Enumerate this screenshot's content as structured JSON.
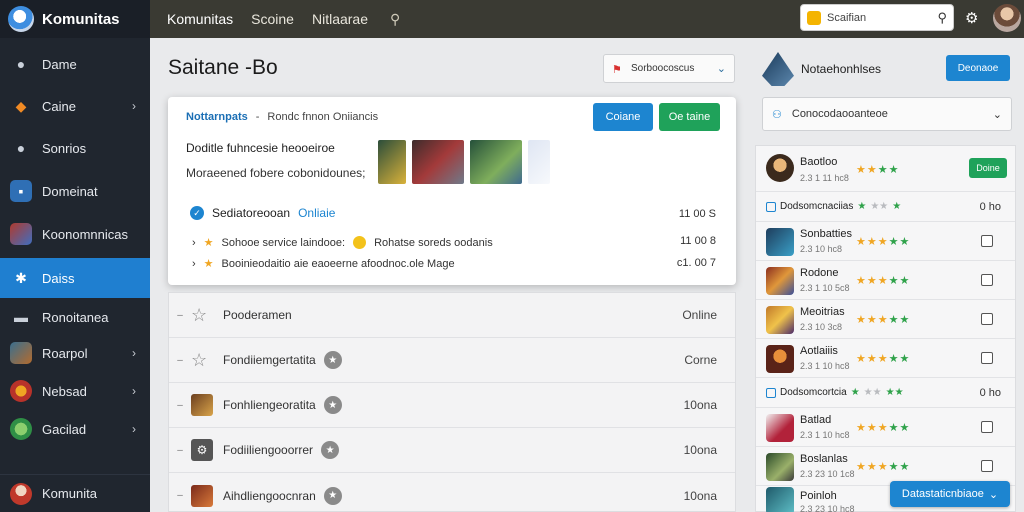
{
  "app": {
    "name": "Komunitas"
  },
  "sidebar": {
    "items": [
      {
        "label": "Dame",
        "icon": "user-icon",
        "chevron": false
      },
      {
        "label": "Caine",
        "icon": "shield-icon",
        "chevron": true
      },
      {
        "label": "Sonrios",
        "icon": "chat-icon",
        "chevron": false
      },
      {
        "label": "Domeinat",
        "icon": "app-icon",
        "chevron": false
      },
      {
        "label": "Koonomnnicas",
        "icon": "game-icon",
        "chevron": false
      },
      {
        "label": "Daiss",
        "icon": "network-icon",
        "chevron": false,
        "active": true
      },
      {
        "label": "Ronoitanea",
        "icon": "card-icon",
        "chevron": false
      },
      {
        "label": "Roarpol",
        "icon": "game2-icon",
        "chevron": true
      },
      {
        "label": "Nebsad",
        "icon": "flame-icon",
        "chevron": true
      },
      {
        "label": "Gacilad",
        "icon": "globe-icon",
        "chevron": true
      }
    ],
    "footer": {
      "label": "Komunita",
      "icon": "avatar-icon"
    }
  },
  "topbar": {
    "tabs": [
      "Komunitas",
      "Scoine",
      "Nitlaarae"
    ],
    "search_placeholder": "Scaifian"
  },
  "main": {
    "title": "Saitane -Bo",
    "select_value": "Sorboocoscus",
    "card": {
      "head_lead": "Nottarnpats",
      "head_sep": "-",
      "head_text": "Rondc fnnon Oniiancis",
      "btn_primary": "Coiane",
      "btn_secondary": "Oe taine",
      "line1": "Doditle fuhncesie",
      "line1_tail": "heooeiroe",
      "line2": "Moraeened fobere cobonidounes;",
      "status_label": "Sediatoreooan",
      "status_online": "Onliaie",
      "status_time": "11 00 S",
      "sub_rows": [
        {
          "text": "Sohooe service laindooe:",
          "extra": "Rohatse soreds oodanis",
          "time": "11 00 8"
        },
        {
          "text": "Booinieodaitio aie eaoeerne afoodnoc.ole Mage",
          "extra": "",
          "time": "c1. 00 7"
        }
      ]
    },
    "list": [
      {
        "label": "Pooderamen",
        "status": "Online",
        "icon": "star-outline-icon"
      },
      {
        "label": "Fondiiemgertatita",
        "status": "Corne",
        "icon": "star-outline-icon"
      },
      {
        "label": "Fonhliengeoratita",
        "status": "10ona",
        "icon": "game-thumb-icon"
      },
      {
        "label": "Fodiiliengooorrer",
        "status": "10ona",
        "icon": "settings-thumb-icon"
      },
      {
        "label": "Aihdliengoocnran",
        "status": "10ona",
        "icon": "game-thumb-icon"
      }
    ]
  },
  "right_panel": {
    "title": "Notaehonhlses",
    "button": "Deonaoe",
    "select_value": "Conocodaooanteoe",
    "rows": [
      {
        "type": "user",
        "name": "Baotloo",
        "sub": "2.3 1 11 hc8",
        "stars": "YYG",
        "action": "Doine"
      },
      {
        "type": "header",
        "name": "Dodsomcnaciias",
        "value": "0 ho"
      },
      {
        "type": "user",
        "name": "Sonbatties",
        "sub": "2.3 10 hc8",
        "stars": "YYG"
      },
      {
        "type": "user",
        "name": "Rodone",
        "sub": "2.3 1 10 5c8",
        "stars": "YYG"
      },
      {
        "type": "user",
        "name": "Meoitrias",
        "sub": "2.3 10 3c8",
        "stars": "YYG"
      },
      {
        "type": "user",
        "name": "Aotlaiiis",
        "sub": "2.3 1 10 hc8",
        "stars": "YYG"
      },
      {
        "type": "header",
        "name": "Dodsomcortcia",
        "value": "0 ho"
      },
      {
        "type": "user",
        "name": "Batlad",
        "sub": "2.3 1 10 hc8",
        "stars": "YYG"
      },
      {
        "type": "user",
        "name": "Boslanlas",
        "sub": "2.3 23 10 1c8",
        "stars": "YYG"
      },
      {
        "type": "user",
        "name": "Poinloh",
        "sub": "2.3 23 10 hc8",
        "stars": "YYG"
      }
    ],
    "bottom_button": "Datastaticnbiaoe"
  },
  "colors": {
    "sidebar_bg": "#20262f",
    "accent_blue": "#1d85d0",
    "accent_green": "#1fa25a",
    "topbar_bg": "#3a3a33"
  }
}
